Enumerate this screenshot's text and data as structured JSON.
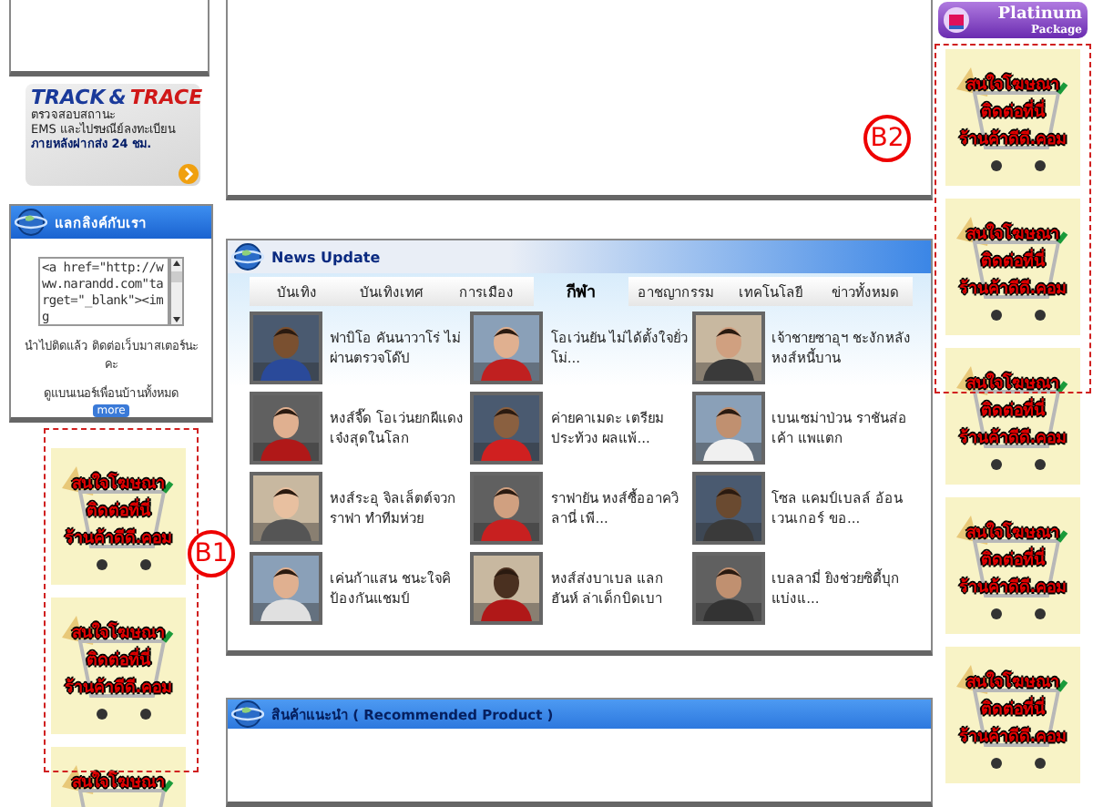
{
  "left_column": {
    "tracking_banner": {
      "title_track": "TRACK",
      "title_amp": "&",
      "title_trace": "TRACE",
      "lines": [
        "ตรวจสอบสถานะ",
        "EMS และไปรษณีย์ลงทะเบียน",
        "ภายหลังฝากส่ง 24 ชม."
      ]
    },
    "link_exchange": {
      "title": "แลกลิงค์กับเรา",
      "code": "<a href=\"http://www.narandd.com\"target=\"_blank\"><img",
      "note": "นำไปติดแล้ว ติดต่อเว็บมาสเตอร์นะคะ",
      "banners_link": "ดูแบนเนอร์เพื่อนบ้านทั้งหมด",
      "more": "more"
    },
    "ads": [
      {
        "lines": [
          "สนใจโฆษณา",
          "ติดต่อที่นี่",
          "ร้านค้าดีดี.คอม"
        ]
      },
      {
        "lines": [
          "สนใจโฆษณา",
          "ติดต่อที่นี่",
          "ร้านค้าดีดี.คอม"
        ]
      },
      {
        "lines": [
          "สนใจโฆษณา"
        ]
      }
    ]
  },
  "news": {
    "title": "News Update",
    "tabs": [
      {
        "label": "บันเทิง",
        "selected": false
      },
      {
        "label": "บันเทิงเทศ",
        "selected": false
      },
      {
        "label": "การเมือง",
        "selected": false
      },
      {
        "label": "กีฬา",
        "selected": true
      },
      {
        "label": "อาชญากรรม",
        "selected": false
      },
      {
        "label": "เทคโนโลยี",
        "selected": false
      },
      {
        "label": "ข่าวทั้งหมด",
        "selected": false
      }
    ],
    "items": [
      {
        "headline": "ฟาบิโอ คันนาวาโร่ ไม่ผ่านตรวจโด๊ป"
      },
      {
        "headline": "โอเว่นยัน ไม่ได้ตั้งใจยั่วโม่..."
      },
      {
        "headline": "เจ้าชายซาอุฯ ชะงักหลังหงส์หนี้บาน"
      },
      {
        "headline": "หงส์จี๊ด โอเว่นยกผีแดง เจ๋งสุดในโลก"
      },
      {
        "headline": "ค่ายคาเมดะ เตรียมประท้วง ผลแพ้..."
      },
      {
        "headline": "เบนเซม่าป่วน ราชันส่อเค้า แพแตก"
      },
      {
        "headline": "หงส์ระอุ จิลเล็ตต์จวกราฟา ทำทีมห่วย"
      },
      {
        "headline": "ราฟายัน หงส์ซื้ออาควิลานี่ เพี..."
      },
      {
        "headline": "โซล แคมป์เบลล์ อ้อนเวนเกอร์ ขอ..."
      },
      {
        "headline": "เค่นก้าแสน ชนะใจคิป้องกันแชมป์"
      },
      {
        "headline": "หงส์ส่งบาเบล แลกฮันห์ ล่าเด็กบิดเบา"
      },
      {
        "headline": "เบลลามี่ ยิงช่วยซิตี้บุกแบ่งแ..."
      }
    ]
  },
  "recommended": {
    "title": "สินค้าแนะนำ ( Recommended Product )"
  },
  "platinum": {
    "title": "Platinum",
    "subtitle": "Package"
  },
  "right_ads": [
    {
      "lines": [
        "สนใจโฆษณา",
        "ติดต่อที่นี่",
        "ร้านค้าดีดี.คอม"
      ]
    },
    {
      "lines": [
        "สนใจโฆษณา",
        "ติดต่อที่นี่",
        "ร้านค้าดีดี.คอม"
      ]
    },
    {
      "lines": [
        "สนใจโฆษณา",
        "ติดต่อที่นี่",
        "ร้านค้าดีดี.คอม"
      ]
    },
    {
      "lines": [
        "สนใจโฆษณา",
        "ติดต่อที่นี่",
        "ร้านค้าดีดี.คอม"
      ]
    },
    {
      "lines": [
        "สนใจโฆษณา",
        "ติดต่อที่นี่",
        "ร้านค้าดีดี.คอม"
      ]
    }
  ],
  "markers": [
    {
      "label": "B1"
    },
    {
      "label": "B2"
    }
  ]
}
